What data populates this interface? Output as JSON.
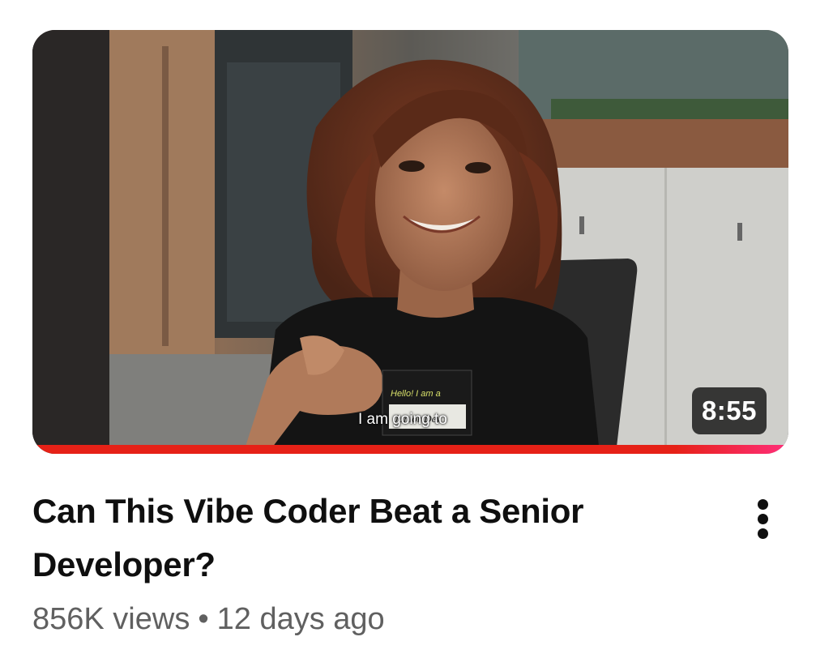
{
  "video": {
    "duration": "8:55",
    "caption": "I am going to",
    "badge_line": "Hello! I am a",
    "badge_name": "Junior Dev",
    "progress_fraction": 1.0,
    "title": "Can This Vibe Coder Beat a Senior Developer?",
    "views": "856K views",
    "separator": "•",
    "age": "12 days ago",
    "menu_icon": "more-vert-icon"
  },
  "colors": {
    "progress": "#e62117",
    "title_text": "#0f0f0f",
    "meta_text": "#606060",
    "duration_bg": "#141414"
  }
}
